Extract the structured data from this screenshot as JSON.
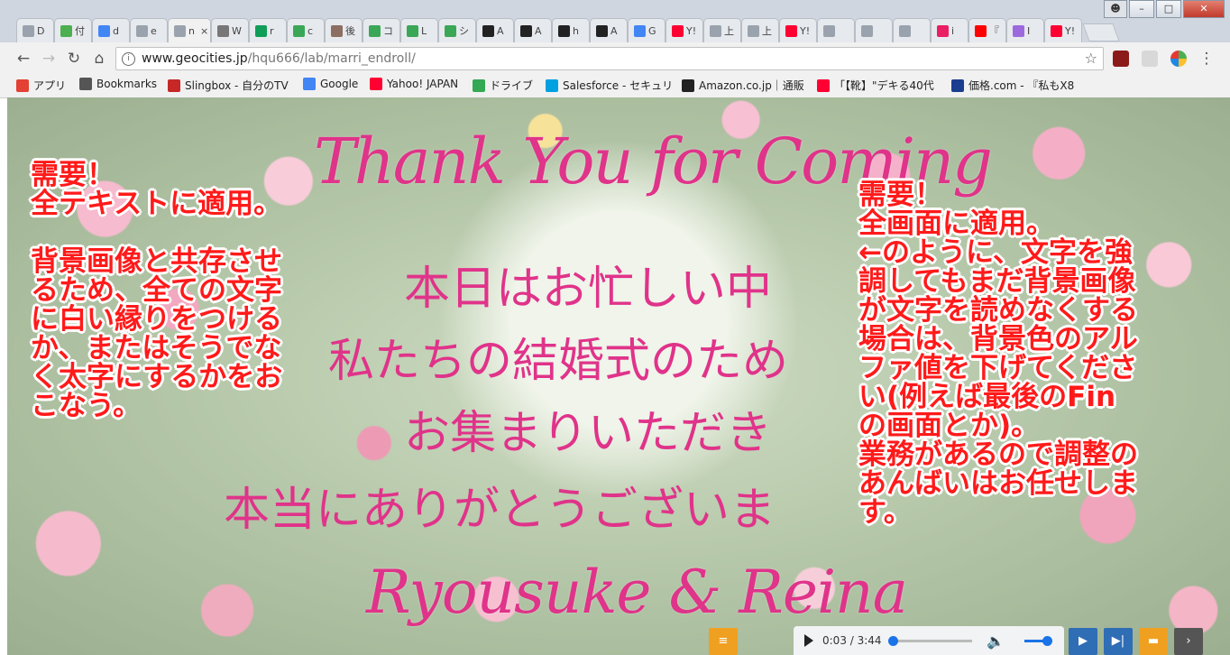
{
  "browser": {
    "tabs": [
      {
        "label": "D",
        "color": "#9aa3ad"
      },
      {
        "label": "付",
        "color": "#4caf50"
      },
      {
        "label": "d",
        "color": "#4285f4"
      },
      {
        "label": "e",
        "color": "#9aa3ad"
      },
      {
        "label": "n",
        "color": "#9aa3ad",
        "active": true
      },
      {
        "label": "W",
        "color": "#777777"
      },
      {
        "label": "r",
        "color": "#0f9d58"
      },
      {
        "label": "c",
        "color": "#3aa757"
      },
      {
        "label": "後",
        "color": "#8d6e63"
      },
      {
        "label": "コ",
        "color": "#3aa757"
      },
      {
        "label": "L",
        "color": "#3aa757"
      },
      {
        "label": "シ",
        "color": "#3aa757"
      },
      {
        "label": "A",
        "color": "#222222"
      },
      {
        "label": "A",
        "color": "#222222"
      },
      {
        "label": "h",
        "color": "#222222"
      },
      {
        "label": "A",
        "color": "#222222"
      },
      {
        "label": "G",
        "color": "#4285f4"
      },
      {
        "label": "Y!",
        "color": "#ff0033"
      },
      {
        "label": "上",
        "color": "#9aa3ad"
      },
      {
        "label": "上",
        "color": "#9aa3ad"
      },
      {
        "label": "Y!",
        "color": "#ff0033"
      },
      {
        "label": "",
        "color": "#9aa3ad"
      },
      {
        "label": "",
        "color": "#9aa3ad"
      },
      {
        "label": "",
        "color": "#9aa3ad"
      },
      {
        "label": "i",
        "color": "#e91e63"
      },
      {
        "label": "『",
        "color": "#ff0000"
      },
      {
        "label": "I",
        "color": "#9c6ade"
      },
      {
        "label": "Y!",
        "color": "#ff0033"
      }
    ],
    "active_tab_close": "×",
    "url_host": "www.geocities.jp",
    "url_path": "/hqu666/lab/marri_endroll/",
    "window_controls": {
      "minimize": "–",
      "maximize": "□",
      "close": "✕"
    }
  },
  "bookmarks": [
    {
      "label": "アプリ",
      "icon": "apps-icon",
      "color": "#e34133"
    },
    {
      "label": "Bookmarks",
      "icon": "star-icon",
      "color": "#555555"
    },
    {
      "label": "Slingbox - 自分のTV",
      "icon": "slingbox-icon",
      "color": "#c62828"
    },
    {
      "label": "Google",
      "icon": "google-icon",
      "color": "#4285f4"
    },
    {
      "label": "Yahoo! JAPAN",
      "icon": "yahoo-icon",
      "color": "#ff0033"
    },
    {
      "label": "ドライブ",
      "icon": "drive-icon",
      "color": "#34a853"
    },
    {
      "label": "Salesforce - セキュリ",
      "icon": "salesforce-icon",
      "color": "#00a1e0"
    },
    {
      "label": "Amazon.co.jp｜通販",
      "icon": "amazon-icon",
      "color": "#222222"
    },
    {
      "label": "「【靴】\"デキる40代",
      "icon": "yahoo-icon",
      "color": "#ff0033"
    },
    {
      "label": "価格.com - 『私もX8",
      "icon": "kakaku-icon",
      "color": "#1a3d8f"
    }
  ],
  "content": {
    "script_title": "Thank You for Coming",
    "jp_lines": [
      "本日はお忙しい中",
      "私たちの結婚式のため",
      "お集まりいただき",
      "本当にありがとうございま"
    ],
    "signature": "Ryousuke & Reina"
  },
  "annotations": {
    "left": [
      "需要！",
      "全テキストに適用。",
      "",
      "背景画像と共存させ",
      "るため、全ての文字",
      "に白い縁りをつける",
      "か、またはそうでな",
      "く太字にするかをお",
      "こなう。"
    ],
    "right": [
      "需要！",
      "全画面に適用。",
      "←のように、文字を強",
      "調してもまだ背景画像",
      "が文字を読めなくする",
      "場合は、背景色のアル",
      "ファ値を下げてくださ",
      "い(例えば最後のFin",
      "の画面とか)。",
      "業務があるので調整の",
      "あんばいはお任せしま",
      "す。"
    ],
    "color": "#ff1a1a"
  },
  "player": {
    "time": "0:03 / 3:44",
    "progress": 0.013,
    "volume": 0.9
  },
  "controls": [
    {
      "name": "list-button",
      "color": "#f0a020",
      "glyph": "≡"
    },
    {
      "name": "play-button",
      "color": "#2f6db5",
      "glyph": "▶"
    },
    {
      "name": "next-button",
      "color": "#2f6db5",
      "glyph": "▶|"
    },
    {
      "name": "comment-button",
      "color": "#f0a020",
      "glyph": "▬"
    },
    {
      "name": "more-button",
      "color": "#555555",
      "glyph": "›"
    }
  ]
}
